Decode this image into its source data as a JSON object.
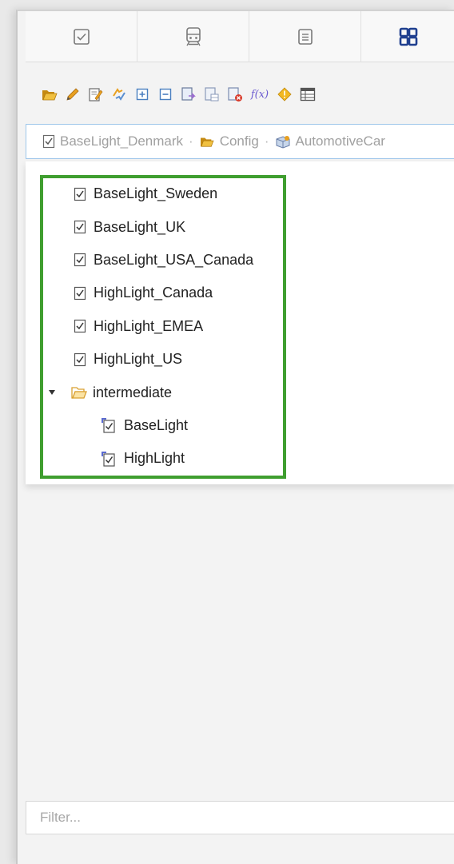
{
  "breadcrumb": {
    "items": [
      {
        "label": "BaseLight_Denmark",
        "icon": "config-file-icon"
      },
      {
        "label": "Config",
        "icon": "folder-open-icon"
      },
      {
        "label": "AutomotiveCar",
        "icon": "package-icon"
      }
    ],
    "separator": "·"
  },
  "tree": {
    "items": [
      {
        "label": "BaseLight_Sweden"
      },
      {
        "label": "BaseLight_UK"
      },
      {
        "label": "BaseLight_USA_Canada"
      },
      {
        "label": "HighLight_Canada"
      },
      {
        "label": "HighLight_EMEA"
      },
      {
        "label": "HighLight_US"
      }
    ],
    "folder": {
      "label": "intermediate",
      "expanded": true,
      "children": [
        {
          "label": "BaseLight"
        },
        {
          "label": "HighLight"
        }
      ]
    }
  },
  "filter": {
    "placeholder": "Filter..."
  },
  "toolbar": {
    "formula_label": "f(x)"
  },
  "colors": {
    "highlight_border": "#3f9e2f",
    "breadcrumb_border": "#9fc7ea",
    "active_tab_icon": "#1f3f8f"
  }
}
